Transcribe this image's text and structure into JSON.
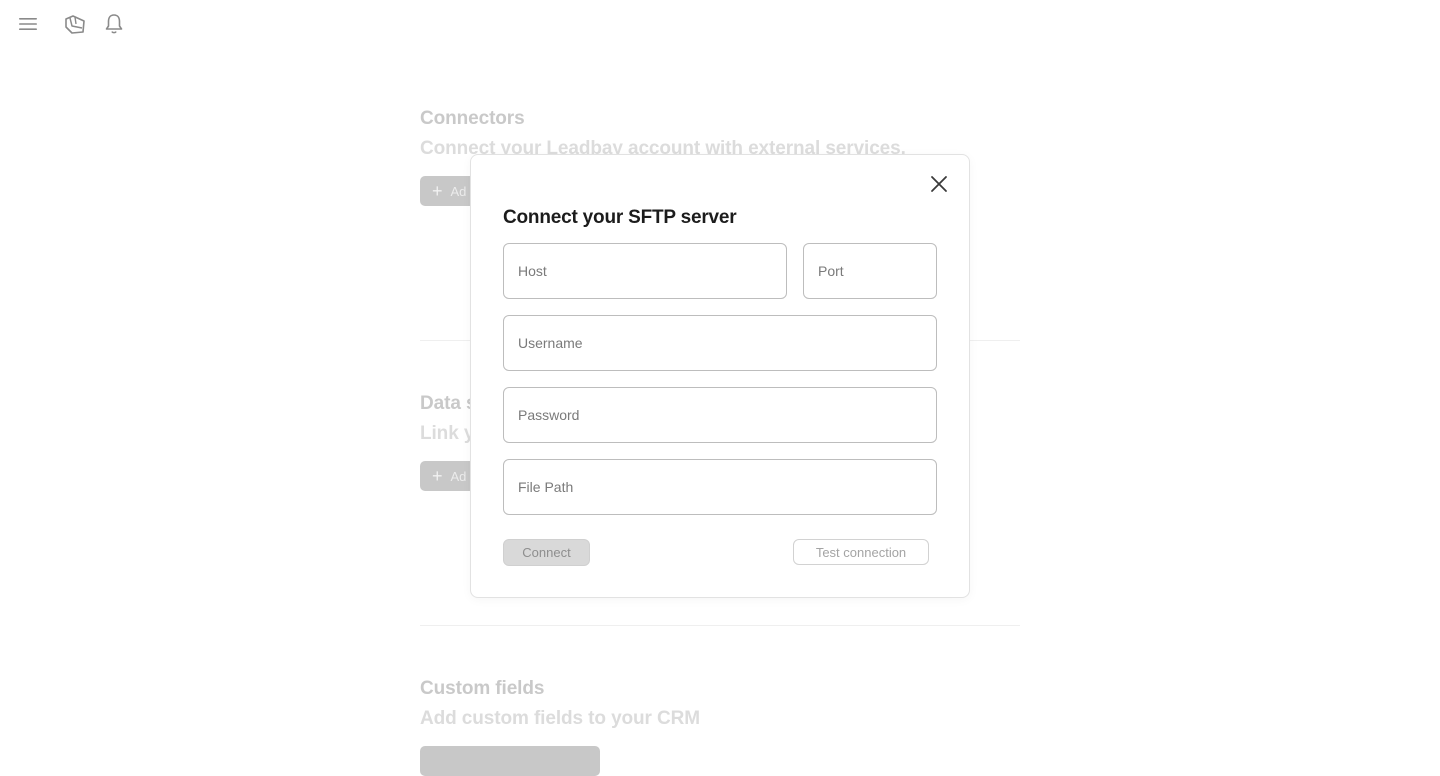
{
  "topbar": {
    "icons": [
      "menu-icon",
      "leadbay-logo-icon",
      "bell-icon"
    ]
  },
  "background": {
    "connectors": {
      "title": "Connectors",
      "subtitle": "Connect your Leadbay account with external services.",
      "add_label": "Ad"
    },
    "data_sources": {
      "title": "Data s",
      "subtitle": "Link y",
      "add_label": "Ad"
    },
    "custom_fields": {
      "title": "Custom fields",
      "subtitle": "Add custom fields to your CRM"
    }
  },
  "modal": {
    "title": "Connect your SFTP server",
    "fields": {
      "host": {
        "placeholder": "Host",
        "value": ""
      },
      "port": {
        "placeholder": "Port",
        "value": ""
      },
      "username": {
        "placeholder": "Username",
        "value": ""
      },
      "password": {
        "placeholder": "Password",
        "value": ""
      },
      "file_path": {
        "placeholder": "File Path",
        "value": ""
      }
    },
    "connect_label": "Connect",
    "test_label": "Test connection"
  }
}
